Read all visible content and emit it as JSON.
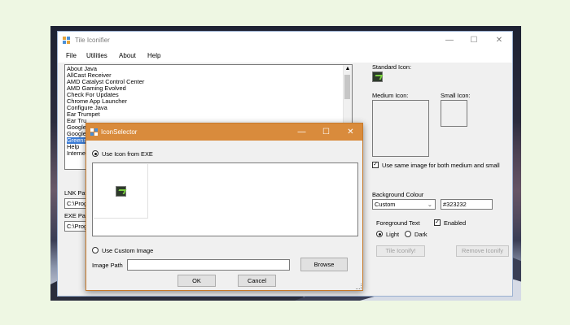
{
  "app": {
    "title": "Tile Iconifier",
    "window_buttons": {
      "minimize": "—",
      "maximize": "☐",
      "close": "✕"
    },
    "menu": [
      "File",
      "Utilities",
      "About",
      "Help"
    ]
  },
  "list": {
    "items": [
      "About Java",
      "AllCast Receiver",
      "AMD Catalyst Control Center",
      "AMD Gaming Evolved",
      "Check For Updates",
      "Chrome App Launcher",
      "Configure Java",
      "Ear Trumpet",
      "Ear Tru",
      "Google",
      "Google",
      "Greenst",
      "Help",
      "Internet"
    ],
    "selected_index": 11
  },
  "paths": {
    "lnk_label": "LNK Pat",
    "lnk_value": "C:\\Prog",
    "exe_label": "EXE Pat",
    "exe_value": "C:\\Prog"
  },
  "right_panel": {
    "standard_icon_label": "Standard Icon:",
    "medium_icon_label": "Medium Icon:",
    "small_icon_label": "Small Icon:",
    "same_image_label": "Use same image for both medium and small",
    "same_image_checked": true,
    "background_colour_label": "Background Colour",
    "background_select": "Custom",
    "background_hex": "#323232",
    "foreground_label": "Foreground Text",
    "enabled_label": "Enabled",
    "enabled_checked": true,
    "light_label": "Light",
    "dark_label": "Dark",
    "tile_iconify_button": "Tile Iconify!",
    "remove_iconify_button": "Remove Iconify"
  },
  "dialog": {
    "title": "IconSelector",
    "buttons": {
      "minimize": "—",
      "maximize": "☐",
      "close": "✕"
    },
    "use_icon_from_exe": "Use Icon from EXE",
    "use_custom_image": "Use Custom Image",
    "image_path_label": "Image Path",
    "image_path_value": "",
    "browse_button": "Browse",
    "ok_button": "OK",
    "cancel_button": "Cancel"
  },
  "colors": {
    "dialog_title_bg": "#d98b3c",
    "selection": "#3a7bd5",
    "tile_color": "#323232",
    "icon_accent": "#7ad040"
  }
}
